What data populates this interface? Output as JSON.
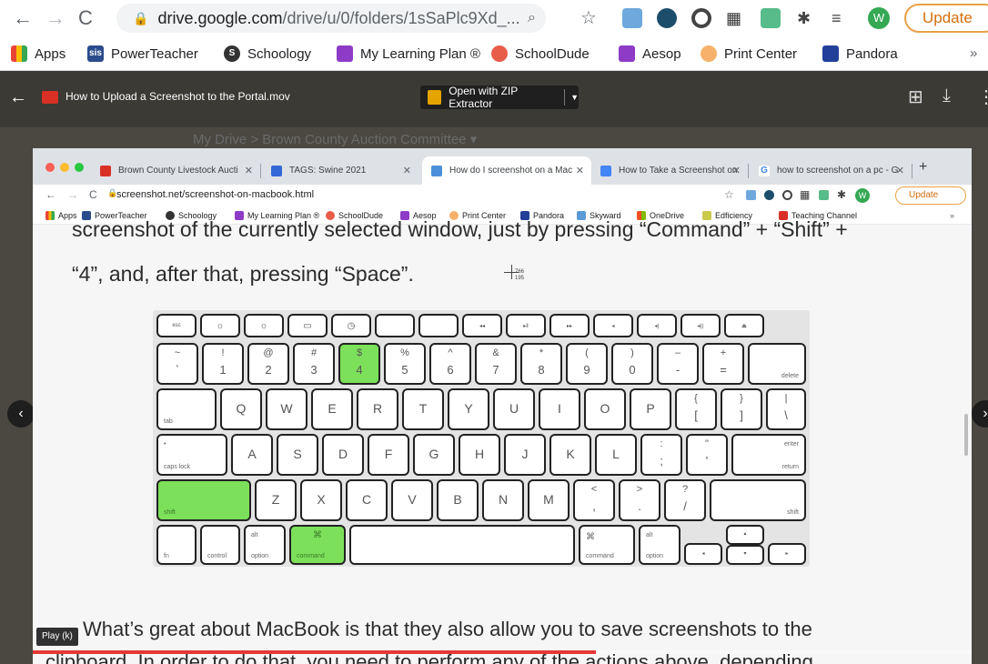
{
  "outer_browser": {
    "url_host": "drive.google.com",
    "url_path": "/drive/u/0/folders/1sSaPlc9Xd_...",
    "update_label": "Update",
    "profile_initial": "W",
    "bookmarks": [
      "Apps",
      "PowerTeacher",
      "Schoology",
      "My Learning Plan ®",
      "SchoolDude",
      "Aesop",
      "Print Center",
      "Pandora"
    ],
    "more_bookmarks": "»"
  },
  "drive_preview": {
    "file_title": "How to Upload a Screenshot to the Portal.mov",
    "open_with_label": "Open with ZIP Extractor",
    "breadcrumb": "My Drive  >  Brown County Auction Committee  ▾"
  },
  "inner_browser": {
    "tabs": [
      {
        "title": "Brown County Livestock Aucti",
        "color": "#d93025"
      },
      {
        "title": "TAGS: Swine 2021",
        "color": "#3367d6"
      },
      {
        "title": "How do I screenshot on a Mac",
        "color": "#4a90d9"
      },
      {
        "title": "How to Take a Screenshot on",
        "color": "#4285f4"
      },
      {
        "title": "how to screenshot on a pc - G",
        "color": "#4285f4"
      }
    ],
    "url": "screenshot.net/screenshot-on-macbook.html",
    "update_label": "Update",
    "profile_initial": "W",
    "bookmarks": [
      "Apps",
      "PowerTeacher",
      "Schoology",
      "My Learning Plan ®",
      "SchoolDude",
      "Aesop",
      "Print Center",
      "Pandora",
      "Skyward",
      "OneDrive",
      "Edficiency",
      "Teaching Channel"
    ],
    "more_bookmarks": "»"
  },
  "article": {
    "line1": "screenshot of the currently selected window, just by pressing “Command” + “Shift” +",
    "line2": "“4”, and, after that, pressing “Space”.",
    "cursor_x": "766",
    "cursor_y": "195",
    "line3": "What’s great about MacBook is that they also allow you to save screenshots to the",
    "line4": "clipboard. In order to do that, you need to perform any of the actions above, depending"
  },
  "keyboard": {
    "highlighted_keys": [
      "$ 4",
      "shift",
      "command"
    ],
    "highlight_color": "#7ce05a"
  },
  "player": {
    "play_tooltip": "Play (k)",
    "progress": 0.6
  }
}
